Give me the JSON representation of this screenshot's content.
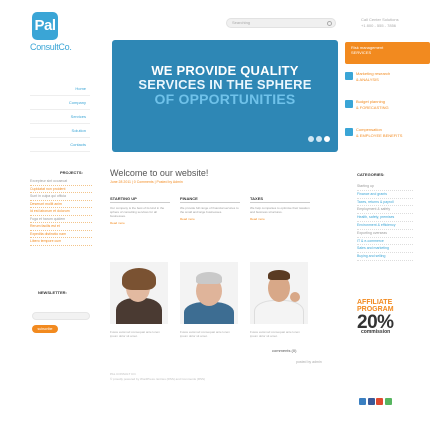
{
  "logo": {
    "mark": "Pal",
    "name": "ConsultCo."
  },
  "header": {
    "search_placeholder": "Searching",
    "contact_lines": [
      "Call Center Solutions",
      "+1 800 - 555 - 7856"
    ]
  },
  "nav": [
    {
      "label": "Home"
    },
    {
      "label": "Company"
    },
    {
      "label": "Services"
    },
    {
      "label": "Solution"
    },
    {
      "label": "Contacts"
    }
  ],
  "hero": {
    "line1": "WE PROVIDE QUALITY",
    "line2": "SERVICES IN THE SPHERE",
    "line3": "OF OPPORTUNITIES",
    "dots": 3
  },
  "services": [
    {
      "title": "Risk management",
      "subtitle": "SERVICES"
    },
    {
      "title": "Marketing research",
      "subtitle": "& ANALYSIS"
    },
    {
      "title": "Budget planning",
      "subtitle": "& FORECASTING"
    },
    {
      "title": "Compensation",
      "subtitle": "& EMPLOYEE BENEFITS"
    }
  ],
  "projects": {
    "heading": "PROJECTS:",
    "items": [
      "Excepteur sint occaecat",
      "Cupidatat non proident",
      "Sunt in culpa qui officia",
      "Deserunt mollit anim",
      "Id est laborum et dolorum",
      "Fuga et harum quidem",
      "Rerum facilis est et",
      "Expedita distinctio nam",
      "Libero tempore cum"
    ]
  },
  "newsletter": {
    "heading": "NEWSLETTER:",
    "button": "subscribe"
  },
  "welcome": {
    "title": "Welcome to our website!",
    "date": "June 28 2011 | 0 Comments | Posted by Admin"
  },
  "columns": [
    {
      "heading": "STARTING UP",
      "text": "Our company is the best of its kind in the sphere of consulting services for all businesses.",
      "link": "Read more"
    },
    {
      "heading": "FINANCE",
      "text": "We provide full range of financial services to the small and large businesses.",
      "link": "Read more"
    },
    {
      "heading": "TAXES",
      "text": "We help companies to optimise their taxation and business structures.",
      "link": "Read more"
    }
  ],
  "captions": [
    "Fusce euismod consequat ante lorem ipsum dolor sit amet.",
    "Fusce euismod consequat ante lorem ipsum dolor sit amet.",
    "Fusce euismod consequat ante lorem ipsum dolor sit amet."
  ],
  "more": {
    "comments": "comments (0)",
    "posted": "posted by admin"
  },
  "categories": {
    "heading": "CATEGORIES:",
    "items": [
      "Starting up",
      "Finance and grants",
      "Taxes, returns & payroll",
      "Employment & safety",
      "Health, safety, premises",
      "Environment & efficiency",
      "Exporting overseas",
      "IT & e-commerce",
      "Sales and marketing",
      "Buying and selling"
    ]
  },
  "affiliate": {
    "line1": "AFFILIATE",
    "line2": "PROGRAM",
    "percent": "20%",
    "label": "commission"
  },
  "footer": {
    "line1": "PAL CONSULT CO.",
    "line2": "© proudly powered by WordPress. Entries (RSS) and Comments (RSS)"
  },
  "colors": {
    "accent_blue": "#3aa5d6",
    "accent_orange": "#f28a1f",
    "hero_blue": "#2e87b5"
  },
  "social": [
    "delicious-icon",
    "facebook-icon",
    "stumbleupon-icon",
    "twitter-icon"
  ]
}
